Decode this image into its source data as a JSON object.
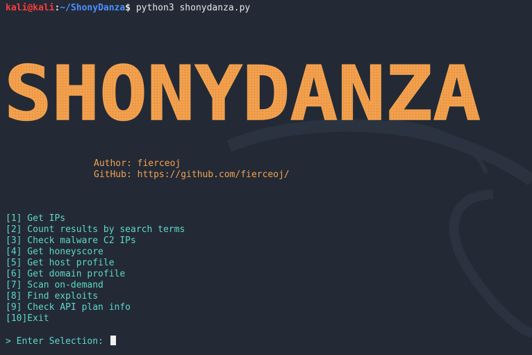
{
  "terminal": {
    "user": "kali",
    "at": "@",
    "host": "kali",
    "colon": ":",
    "path": "~/ShonyDanza",
    "dollar": "$",
    "command": " python3 shonydanza.py"
  },
  "banner": {
    "text": "SHONYDANZA",
    "color": "#f4a24f"
  },
  "author_info": {
    "author": "Author: fierceoj",
    "github": "GitHub: https://github.com/fierceoj/"
  },
  "menu": {
    "items": [
      "[1] Get IPs",
      "[2] Count results by search terms",
      "[3] Check malware C2 IPs",
      "[4] Get honeyscore",
      "[5] Get host profile",
      "[6] Get domain profile",
      "[7] Scan on-demand",
      "[8] Find exploits",
      "[9] Check API plan info",
      "[10]Exit"
    ]
  },
  "input": {
    "prompt": "> Enter Selection: "
  },
  "colors": {
    "background": "#232a36",
    "menu_text": "#5fd7c7",
    "user_host": "#ff3b3b",
    "path": "#4d8dff",
    "banner": "#f4a24f"
  }
}
